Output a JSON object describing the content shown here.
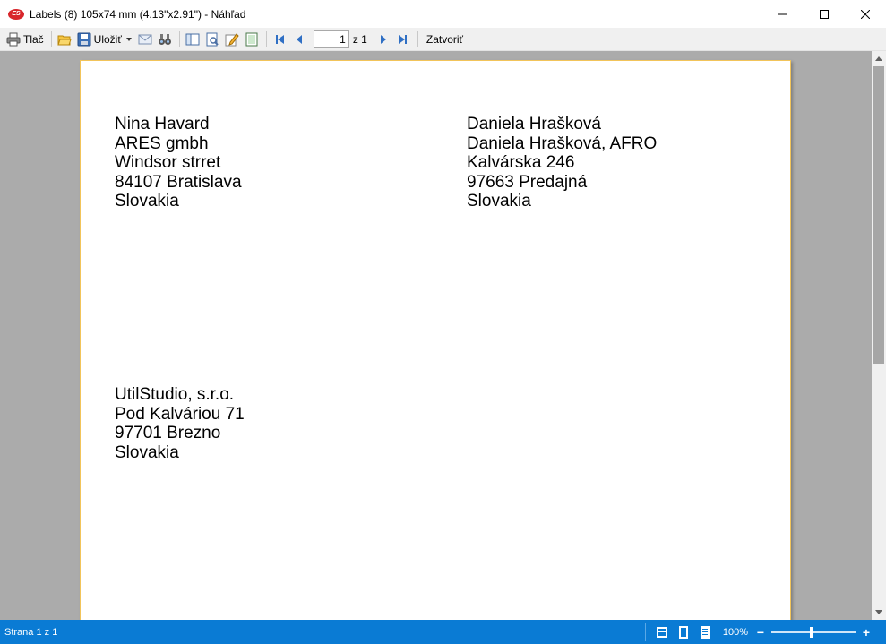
{
  "window": {
    "title": "Labels (8) 105x74 mm (4.13\"x2.91\") - Náhľad",
    "logo_text": "ES"
  },
  "toolbar": {
    "print_label": "Tlač",
    "save_label": "Uložiť",
    "page_current": "1",
    "page_of": "z 1",
    "close_label": "Zatvoriť"
  },
  "labels": [
    {
      "lines": [
        "Nina Havard",
        "ARES gmbh",
        "Windsor strret",
        "84107 Bratislava",
        "Slovakia"
      ]
    },
    {
      "lines": [
        "Daniela Hrašková",
        "Daniela Hrašková, AFRO",
        "Kalvárska 246",
        "97663 Predajná",
        "Slovakia"
      ]
    },
    {
      "lines": [
        "UtilStudio, s.r.o.",
        "Pod Kalváriou 71",
        "97701 Brezno",
        "Slovakia"
      ]
    }
  ],
  "status": {
    "page_text": "Strana 1 z 1",
    "zoom": "100%",
    "zoom_minus": "−",
    "zoom_plus": "+"
  },
  "colors": {
    "statusbar": "#0a7bd4",
    "page_border": "#f2c45a",
    "preview_bg": "#ababab"
  }
}
